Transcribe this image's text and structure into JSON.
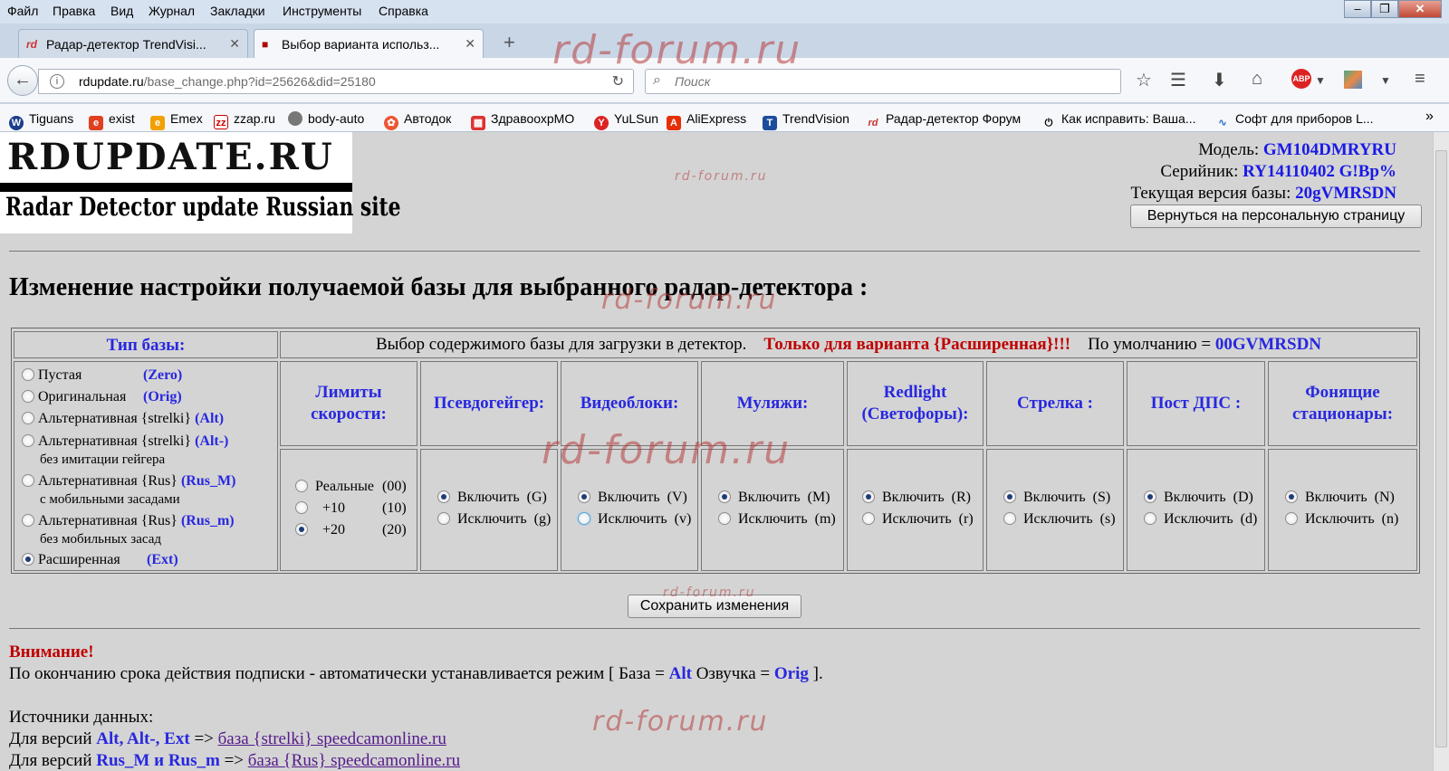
{
  "browser": {
    "menu": [
      "Файл",
      "Правка",
      "Вид",
      "Журнал",
      "Закладки",
      "Инструменты",
      "Справка"
    ],
    "tabs": [
      {
        "label": "Радар-детектор TrendVisi...",
        "active": false
      },
      {
        "label": "Выбор варианта использ...",
        "active": true
      }
    ],
    "url_host": "rdupdate.ru",
    "url_path": "/base_change.php?id=25626&did=25180",
    "search_placeholder": "Поиск",
    "bookmarks": [
      "Tiguans",
      "exist",
      "Emex",
      "zzap.ru",
      "body-auto",
      "Автодок",
      "ЗдравоохрМО",
      "YuLSun",
      "AliExpress",
      "TrendVision",
      "Радар-детектор Форум",
      "Как исправить: Ваша...",
      "Софт для приборов L..."
    ]
  },
  "watermark": "rd-forum.ru",
  "logo": {
    "line1": "RDUPDATE.RU",
    "line2": "Radar Detector update Russian site"
  },
  "device": {
    "model_label": "Модель:",
    "model": "GM104DMRYRU",
    "serial_label": "Серийник:",
    "serial": "RY14110402 G!Bp%",
    "version_label": "Текущая версия базы:",
    "version": "20gVMRSDN",
    "back_button": "Вернуться на персональную страницу"
  },
  "heading": "Изменение настройки получаемой базы для выбранного радар-детектора :",
  "base_type": {
    "title": "Тип базы:",
    "options": [
      {
        "label": "Пустая",
        "code": "(Zero)",
        "sub": "",
        "checked": false
      },
      {
        "label": "Оригинальная",
        "code": "(Orig)",
        "sub": "",
        "checked": false
      },
      {
        "label": "Альтернативная {strelki}",
        "code": "(Alt)",
        "sub": "",
        "checked": false
      },
      {
        "label": "Альтернативная {strelki}",
        "code": "(Alt-)",
        "sub": "без имитации гейгера",
        "checked": false
      },
      {
        "label": "Альтернативная {Rus}",
        "code": "(Rus_M)",
        "sub": "с мобильными засадами",
        "checked": false
      },
      {
        "label": "Альтернативная {Rus}",
        "code": "(Rus_m)",
        "sub": "без мобильных засад",
        "checked": false
      },
      {
        "label": "Расширенная",
        "code": "(Ext)",
        "sub": "",
        "checked": true
      }
    ]
  },
  "content": {
    "intro": "Выбор содержимого базы для загрузки в детектор.",
    "only_ext": "Только для варианта {Расширенная}!!!",
    "default_label": "По умолчанию =",
    "default_value": "00GVMRSDN",
    "columns": [
      {
        "title": "Лимиты скорости:",
        "options": [
          {
            "label": "Реальные",
            "code": "(00)",
            "checked": false
          },
          {
            "label": "+10",
            "code": "(10)",
            "checked": false
          },
          {
            "label": "+20",
            "code": "(20)",
            "checked": true
          }
        ]
      },
      {
        "title": "Псевдогейгер:",
        "options": [
          {
            "label": "Включить",
            "code": "(G)",
            "checked": true
          },
          {
            "label": "Исключить",
            "code": "(g)",
            "checked": false
          }
        ]
      },
      {
        "title": "Видеоблоки:",
        "options": [
          {
            "label": "Включить",
            "code": "(V)",
            "checked": true
          },
          {
            "label": "Исключить",
            "code": "(v)",
            "checked": false
          }
        ]
      },
      {
        "title": "Муляжи:",
        "options": [
          {
            "label": "Включить",
            "code": "(M)",
            "checked": true
          },
          {
            "label": "Исключить",
            "code": "(m)",
            "checked": false
          }
        ]
      },
      {
        "title": "Redlight (Светофоры):",
        "options": [
          {
            "label": "Включить",
            "code": "(R)",
            "checked": true
          },
          {
            "label": "Исключить",
            "code": "(r)",
            "checked": false
          }
        ]
      },
      {
        "title": "Стрелка :",
        "options": [
          {
            "label": "Включить",
            "code": "(S)",
            "checked": true
          },
          {
            "label": "Исключить",
            "code": "(s)",
            "checked": false
          }
        ]
      },
      {
        "title": "Пост ДПС :",
        "options": [
          {
            "label": "Включить",
            "code": "(D)",
            "checked": true
          },
          {
            "label": "Исключить",
            "code": "(d)",
            "checked": false
          }
        ]
      },
      {
        "title": "Фонящие стационары:",
        "options": [
          {
            "label": "Включить",
            "code": "(N)",
            "checked": true
          },
          {
            "label": "Исключить",
            "code": "(n)",
            "checked": false
          }
        ]
      }
    ]
  },
  "save_button": "Сохранить изменения",
  "notice": {
    "title": "Внимание!",
    "text_a": "По окончанию срока действия подписки - автоматически устанавливается режим [ База =",
    "alt": "Alt",
    "text_b": "Озвучка =",
    "orig": "Orig",
    "text_c": "].",
    "sources": "Источники данных:",
    "src1_a": "Для версий",
    "src1_b": "Alt, Alt-, Ext",
    "src1_c": "=>",
    "src1_link": "база {strelki} speedcamonline.ru",
    "src2_a": "Для версий",
    "src2_b": "Rus_M и Rus_m",
    "src2_c": "=>",
    "src2_link": "база {Rus} speedcamonline.ru"
  }
}
